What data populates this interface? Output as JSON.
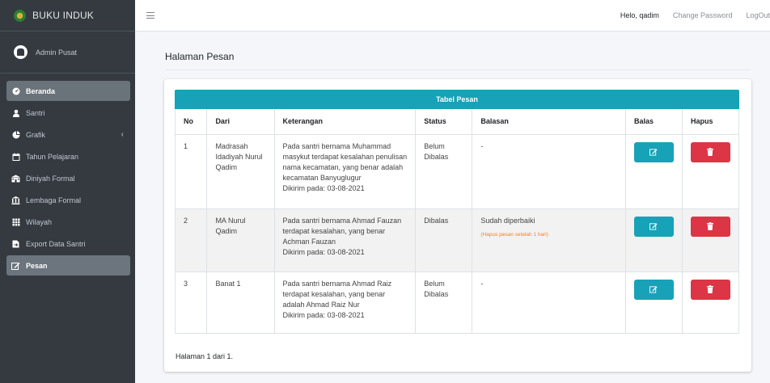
{
  "brand": {
    "title": "BUKU INDUK"
  },
  "user": {
    "name": "Admin Pusat"
  },
  "sidebar": {
    "items": [
      {
        "label": "Beranda"
      },
      {
        "label": "Santri"
      },
      {
        "label": "Grafik"
      },
      {
        "label": "Tahun Pelajaran"
      },
      {
        "label": "Diniyah Formal"
      },
      {
        "label": "Lembaga Formal"
      },
      {
        "label": "Wilayah"
      },
      {
        "label": "Export Data Santri"
      },
      {
        "label": "Pesan"
      }
    ]
  },
  "topbar": {
    "greeting": "Helo, qadim",
    "change_password": "Change Password",
    "logout": "LogOut"
  },
  "page": {
    "title": "Halaman Pesan"
  },
  "table": {
    "caption": "Tabel Pesan",
    "headers": [
      "No",
      "Dari",
      "Keterangan",
      "Status",
      "Balasan",
      "Balas",
      "Hapus"
    ],
    "rows": [
      {
        "no": "1",
        "dari": "Madrasah Idadiyah Nurul Qadim",
        "keterangan": "Pada santri bernama Muhammad masykut terdapat kesalahan penulisan nama kecamatan, yang benar adalah kecamatan Banyuglugur",
        "dikirim": "Dikirim pada: 03-08-2021",
        "status": "Belum Dibalas",
        "balasan": "-",
        "note": ""
      },
      {
        "no": "2",
        "dari": "MA Nurul Qadim",
        "keterangan": "Pada santri bernama Ahmad Fauzan terdapat kesalahan, yang benar Achman Fauzan",
        "dikirim": "Dikirim pada: 03-08-2021",
        "status": "Dibalas",
        "balasan": "Sudah diperbaiki",
        "note": "(Hapus pesan setelah 1 hari)"
      },
      {
        "no": "3",
        "dari": "Banat 1",
        "keterangan": "Pada santri bernama Ahmad Raiz terdapat kesalahan, yang benar adalah Ahmad Raiz Nur",
        "dikirim": "Dikirim pada: 03-08-2021",
        "status": "Belum Dibalas",
        "balasan": "-",
        "note": ""
      }
    ]
  },
  "pagination": {
    "text": "Halaman 1 dari 1."
  },
  "colors": {
    "sidebar": "#343a40",
    "info": "#17a2b8",
    "danger": "#dc3545",
    "note": "#fd7e14"
  }
}
